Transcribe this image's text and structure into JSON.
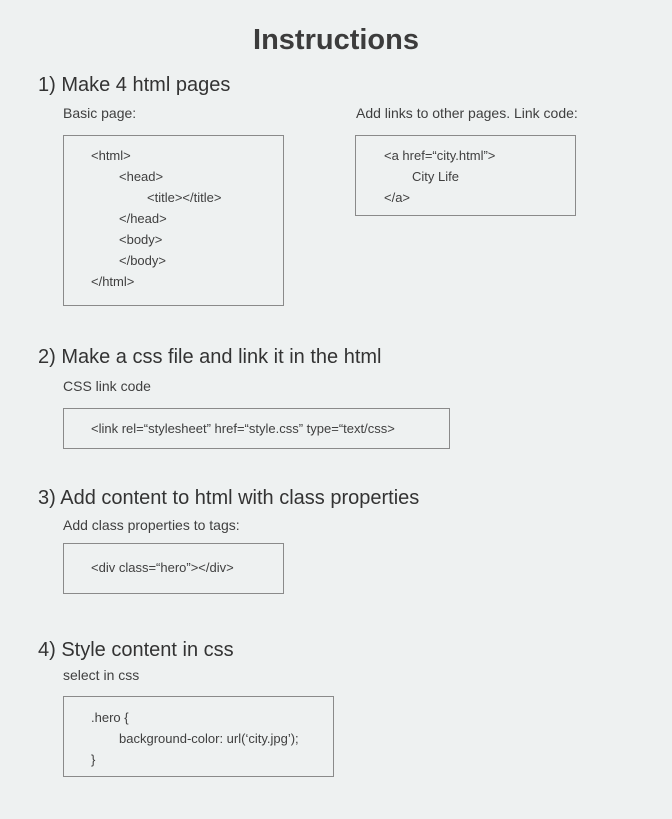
{
  "page_title": "Instructions",
  "steps": [
    {
      "heading": "1) Make 4 html pages",
      "left_label": "Basic page:",
      "left_code": [
        "<html>",
        "<head>",
        "<title></title>",
        "</head>",
        "<body>",
        "</body>",
        "</html>"
      ],
      "right_label": "Add links to other pages. Link code:",
      "right_code": [
        "<a href=“city.html”>",
        "City Life",
        "</a>"
      ]
    },
    {
      "heading": "2) Make a css file and link it in the html",
      "label": "CSS link code",
      "code": [
        "<link rel=“stylesheet” href=“style.css” type=“text/css>"
      ]
    },
    {
      "heading": "3) Add content to html with class properties",
      "label": "Add class properties to tags:",
      "code": [
        "<div class=“hero”></div>"
      ]
    },
    {
      "heading": "4) Style content in css",
      "label": "select in css",
      "code": [
        ".hero {",
        "background-color: url(‘city.jpg’);",
        "}"
      ]
    }
  ]
}
